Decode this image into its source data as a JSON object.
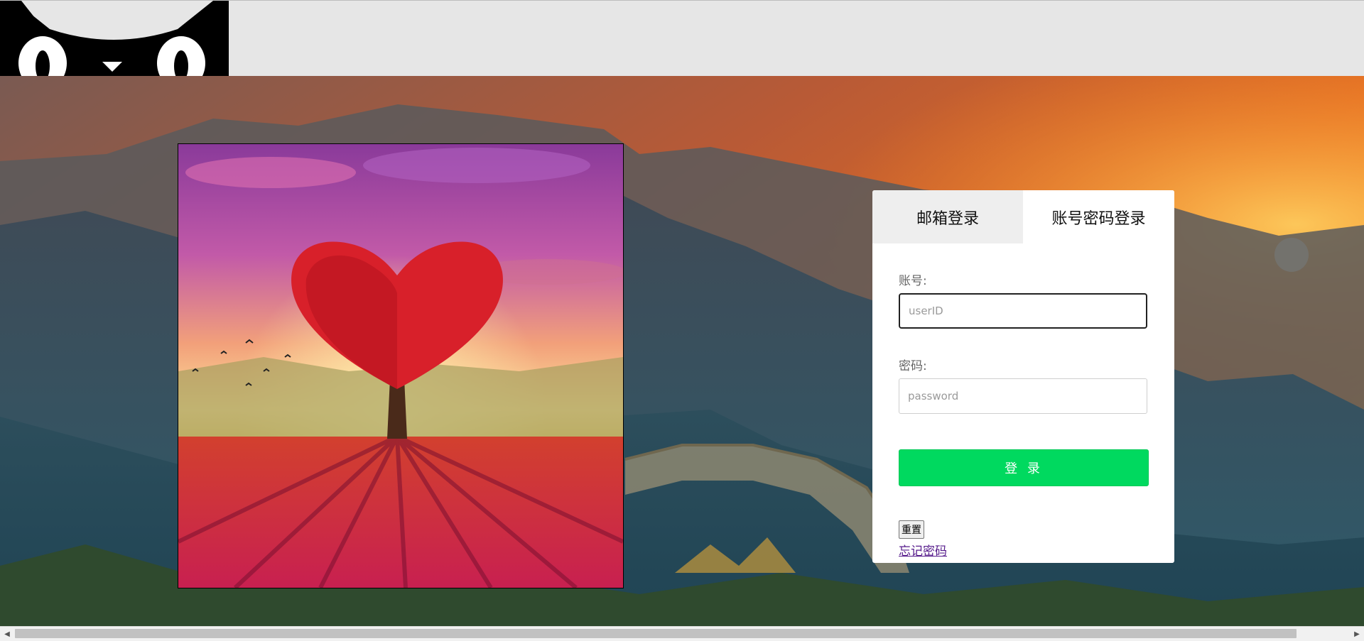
{
  "login": {
    "tabs": {
      "email": "邮箱登录",
      "account": "账号密码登录"
    },
    "account_label": "账号:",
    "account_placeholder": "userID",
    "password_label": "密码:",
    "password_placeholder": "password",
    "login_button": "登 录",
    "reset_button": "重置",
    "forgot_link": "忘记密码"
  },
  "colors": {
    "login_button": "#00d95f",
    "link": "#551a8b",
    "header_bg": "#e6e6e6"
  },
  "icons": {
    "logo": "cat-logo-icon",
    "scroll_left": "scroll-left-arrow-icon",
    "scroll_right": "scroll-right-arrow-icon"
  }
}
